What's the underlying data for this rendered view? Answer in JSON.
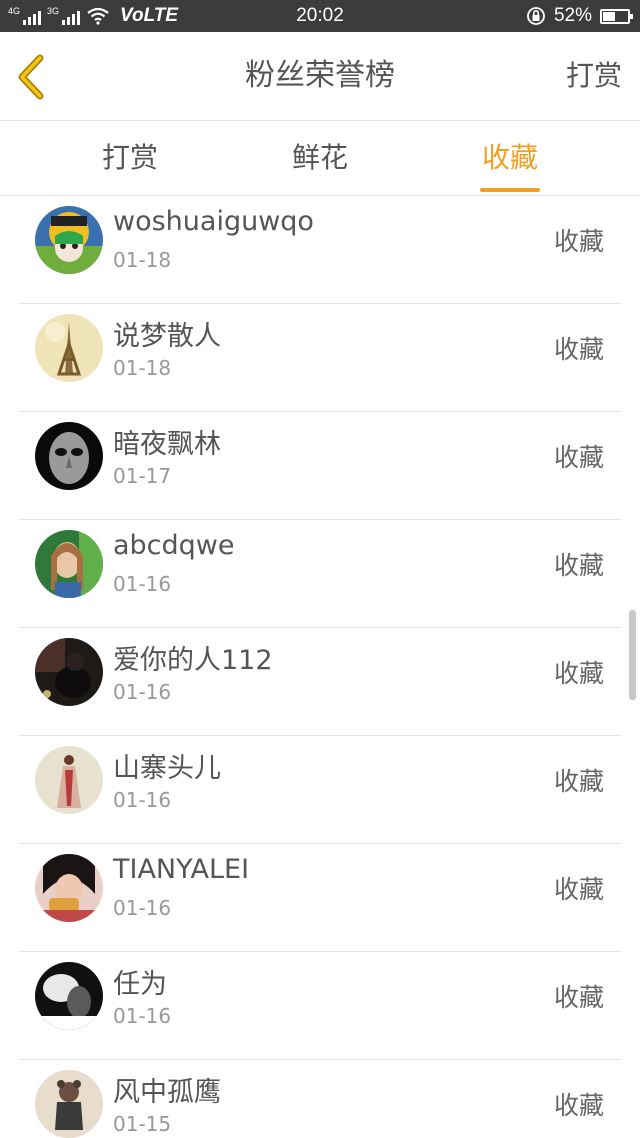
{
  "status_bar": {
    "network_left": "4G",
    "network_right": "3G",
    "volte": "VoLTE",
    "time": "20:02",
    "battery": "52%",
    "battery_level": 0.52
  },
  "header": {
    "title": "粉丝荣誉榜",
    "action": "打赏"
  },
  "tabs": [
    {
      "label": "打赏",
      "active": false
    },
    {
      "label": "鲜花",
      "active": false
    },
    {
      "label": "收藏",
      "active": true
    }
  ],
  "colors": {
    "accent": "#f0a020",
    "status_bar_bg": "#3c3c3c"
  },
  "list": [
    {
      "name": "woshuaiguwqo",
      "date": "01-18",
      "action": "收藏"
    },
    {
      "name": "说梦散人",
      "date": "01-18",
      "action": "收藏"
    },
    {
      "name": "暗夜飘林",
      "date": "01-17",
      "action": "收藏"
    },
    {
      "name": "abcdqwe",
      "date": "01-16",
      "action": "收藏"
    },
    {
      "name": "爱你的人112",
      "date": "01-16",
      "action": "收藏"
    },
    {
      "name": "山寨头儿",
      "date": "01-16",
      "action": "收藏"
    },
    {
      "name": "TIANYALEI",
      "date": "01-16",
      "action": "收藏"
    },
    {
      "name": "任为",
      "date": "01-16",
      "action": "收藏"
    },
    {
      "name": "风中孤鹰",
      "date": "01-15",
      "action": "收藏"
    }
  ]
}
